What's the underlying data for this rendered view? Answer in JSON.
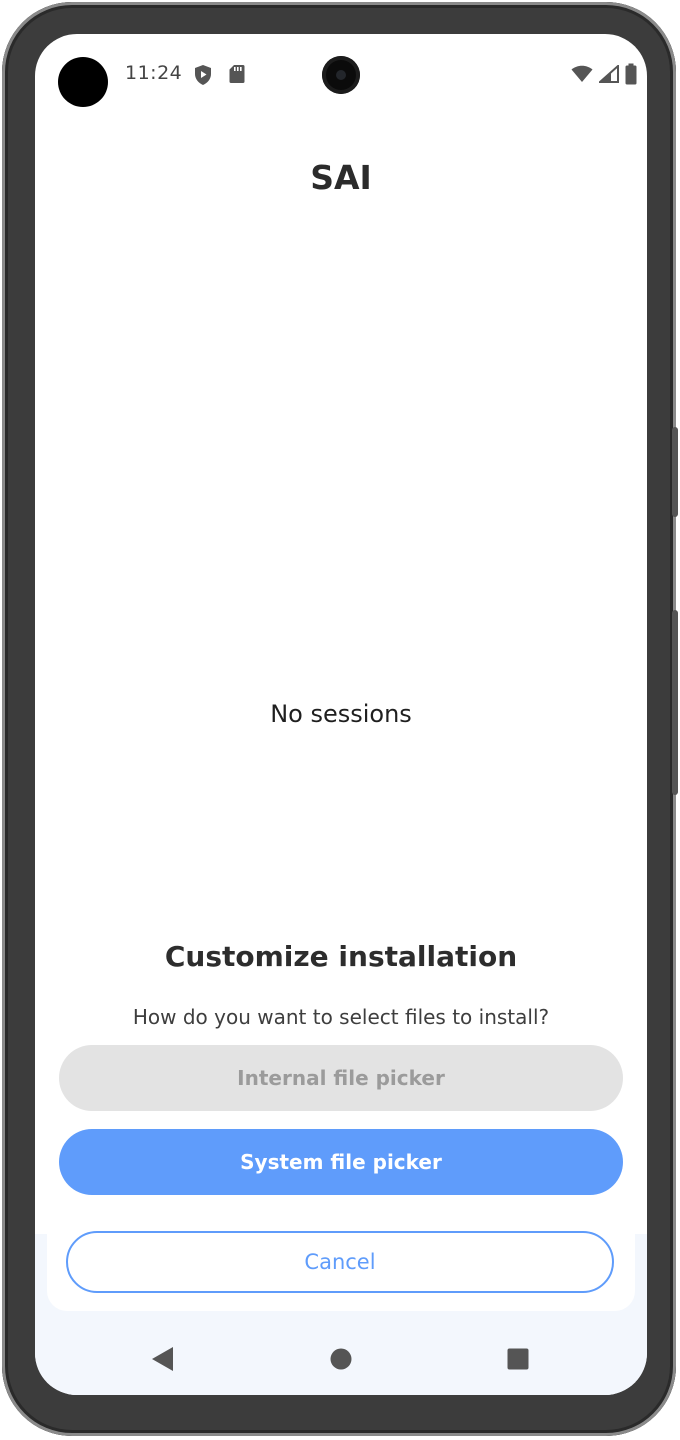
{
  "status_bar": {
    "time": "11:24",
    "icons": [
      "shield-play-icon",
      "sd-card-icon",
      "wifi-icon",
      "cellular-signal-icon",
      "battery-icon"
    ]
  },
  "app": {
    "title": "SAI",
    "empty_message": "No sessions"
  },
  "sheet": {
    "title": "Customize installation",
    "question": "How do you want to select files to install?",
    "internal_picker_label": "Internal file picker",
    "system_picker_label": "System file picker",
    "cancel_label": "Cancel"
  },
  "nav_bar": {
    "buttons": [
      "back-icon",
      "home-icon",
      "recents-icon"
    ]
  },
  "colors": {
    "accent": "#5f9cfb",
    "disabled_bg": "#e3e3e3",
    "disabled_text": "#9b9b9b",
    "nav_bg": "#f3f7fd"
  }
}
